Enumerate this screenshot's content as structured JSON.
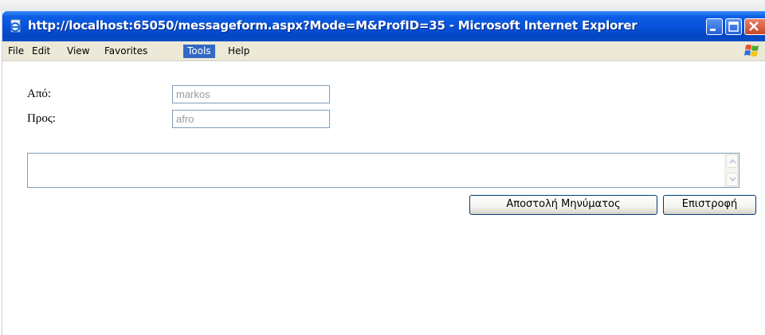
{
  "window": {
    "title": "http://localhost:65050/messageform.aspx?Mode=M&ProfID=35 - Microsoft Internet Explorer"
  },
  "menu": {
    "items": [
      "File",
      "Edit",
      "View",
      "Favorites",
      "Tools",
      "Help"
    ],
    "active": "Tools"
  },
  "form": {
    "from_label": "Από:",
    "from_value": "markos",
    "to_label": "Προς:",
    "to_value": "afro",
    "message_value": "",
    "send_label": "Αποστολή Μηνύματος",
    "back_label": "Επιστροφή"
  },
  "colors": {
    "titlebar": "#0650d8",
    "menubar": "#ece9d8",
    "menu_highlight": "#316ac5",
    "input_border": "#7f9db9",
    "input_text": "#9a9a9a"
  },
  "icons": {
    "title": "ie-page-icon",
    "minimize": "minimize-icon",
    "maximize": "maximize-icon",
    "close": "close-icon",
    "logo": "windows-flag-icon",
    "scroll_up": "scroll-up-arrow-icon",
    "scroll_down": "scroll-down-arrow-icon"
  }
}
